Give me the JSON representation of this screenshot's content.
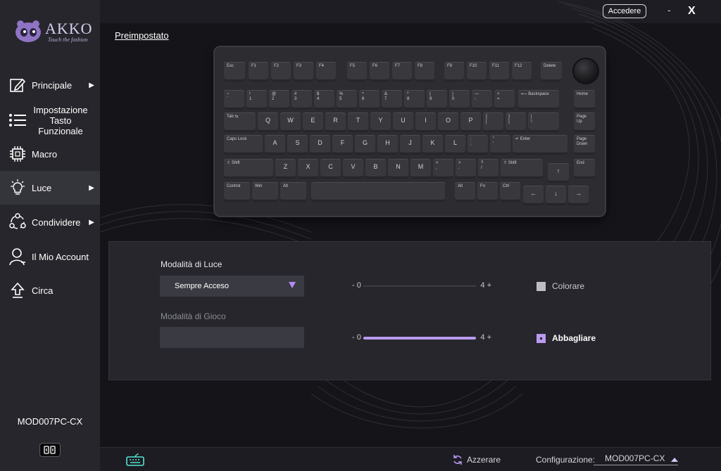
{
  "brand": {
    "name": "AKKO",
    "tagline": "Touch the fashion"
  },
  "window": {
    "login_label": "Accedere",
    "minimize_label": "-",
    "close_label": "X"
  },
  "sidebar": {
    "items": [
      {
        "label": "Principale",
        "icon": "edit-icon",
        "has_arrow": true
      },
      {
        "label": "Impostazione Tasto Funzionale",
        "icon": "list-icon",
        "has_arrow": false
      },
      {
        "label": "Macro",
        "icon": "chip-icon",
        "has_arrow": false
      },
      {
        "label": "Luce",
        "icon": "bulb-icon",
        "has_arrow": true,
        "active": true
      },
      {
        "label": "Condividere",
        "icon": "share-icon",
        "has_arrow": true
      },
      {
        "label": "Il Mio Account",
        "icon": "user-icon",
        "has_arrow": false
      },
      {
        "label": "Circa",
        "icon": "upload-icon",
        "has_arrow": false
      }
    ],
    "arrow_glyph": "▶",
    "device_name": "MOD007PC-CX",
    "device_icon": "device-switch-icon"
  },
  "main": {
    "preset_label": "Preimpostato"
  },
  "keyboard": {
    "rows": [
      [
        "Esc",
        "F1",
        "F2",
        "F3",
        "F4",
        "F5",
        "F6",
        "F7",
        "F8",
        "F9",
        "F10",
        "F11",
        "F12",
        "Delete"
      ],
      [
        "~\n`",
        "!\n1",
        "@\n2",
        "#\n3",
        "$\n4",
        "%\n5",
        "^\n6",
        "&\n7",
        "*\n8",
        "(\n9",
        ")\n0",
        "—\n-",
        "+\n=",
        "⟵ Backspace",
        "Home"
      ],
      [
        "Tab ⇆",
        "Q",
        "W",
        "E",
        "R",
        "T",
        "Y",
        "U",
        "I",
        "O",
        "P",
        "{\n[",
        "}\n]",
        "|\n\\",
        "Page\nUp"
      ],
      [
        "Caps Lock",
        "A",
        "S",
        "D",
        "F",
        "G",
        "H",
        "J",
        "K",
        "L",
        ":\n;",
        "\"\n'",
        "↵ Enter",
        "Page\nDown"
      ],
      [
        "⇧ Shift",
        "Z",
        "X",
        "C",
        "V",
        "B",
        "N",
        "M",
        "<\n,",
        ">\n.",
        "?\n/",
        "⇧ Shift",
        "↑",
        "End"
      ],
      [
        "Control",
        "Win",
        "Alt",
        "",
        "Alt",
        "Fn",
        "Ctrl",
        "←",
        "↓",
        "→"
      ]
    ]
  },
  "light": {
    "mode_label": "Modalità di Luce",
    "mode_value": "Sempre Acceso",
    "game_label": "Modalità di Gioco",
    "game_value": "",
    "slider_minus": "- 0",
    "slider_plus": "4 +",
    "slider1_level": 0,
    "slider2_level": 1.0,
    "color_label": "Colorare",
    "color_checked": false,
    "dazzle_label": "Abbagliare",
    "dazzle_checked": true
  },
  "footer": {
    "reset_label": "Azzerare",
    "config_label": "Configurazione:",
    "config_value": "MOD007PC-CX"
  },
  "colors": {
    "accent": "#b99af0",
    "sidebar_bg": "#26262c",
    "panel_bg": "#26262c",
    "active_item": "#34343b",
    "footer_icon": "#54e6d6"
  }
}
